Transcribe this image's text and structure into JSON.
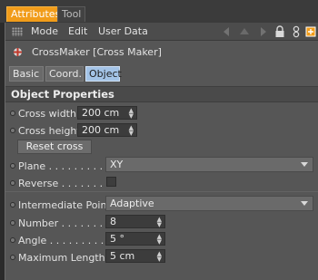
{
  "tabs": [
    {
      "label": "Attributes"
    },
    {
      "label": "Tool"
    }
  ],
  "menubar": {
    "items": [
      "Mode",
      "Edit",
      "User Data"
    ]
  },
  "object": {
    "name": "CrossMaker [Cross Maker]"
  },
  "subtabs": [
    "Basic",
    "Coord.",
    "Object"
  ],
  "section": {
    "title": "Object Properties"
  },
  "properties": {
    "cross_width": {
      "label": "Cross width",
      "value": "200 cm"
    },
    "cross_height": {
      "label": "Cross height",
      "value": "200 cm"
    },
    "reset_button": "Reset cross",
    "plane": {
      "label": "Plane . . . . . . . . . . .",
      "value": "XY"
    },
    "reverse": {
      "label": "Reverse . . . . . . . .",
      "checked": false
    },
    "intermediate_points": {
      "label": "Intermediate Points",
      "value": "Adaptive"
    },
    "number": {
      "label": "Number . . . . . . . .",
      "value": "8"
    },
    "angle": {
      "label": "Angle . . . . . . . . . . .",
      "value": "5 °"
    },
    "maximum_length": {
      "label": "Maximum Length",
      "value": "5 cm"
    }
  },
  "colors": {
    "active_tab": "#f19c1a",
    "selected_subtab": "#a3c3e6",
    "panel": "#565656"
  },
  "icons": [
    "grip-icon",
    "back-arrow-icon",
    "up-arrow-icon",
    "forward-arrow-icon",
    "lock-icon",
    "link-icon",
    "new-panel-icon",
    "crossmaker-object-icon"
  ]
}
